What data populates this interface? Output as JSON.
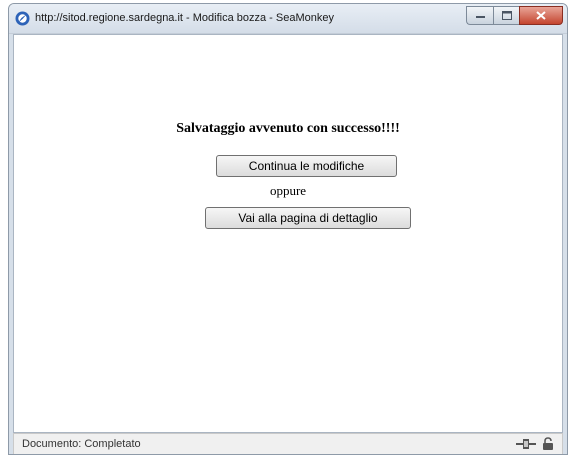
{
  "window": {
    "title": "http://sitod.regione.sardegna.it - Modifica bozza - SeaMonkey"
  },
  "page": {
    "message": "Salvataggio avvenuto con successo!!!!",
    "continue_button": "Continua le modifiche",
    "or_text": "oppure",
    "detail_button": "Vai alla pagina di dettaglio"
  },
  "statusbar": {
    "text": "Documento: Completato",
    "icons": [
      "network-icon",
      "lock-icon"
    ]
  },
  "colors": {
    "titlebar": "#d4dde8",
    "close_button": "#c4452f",
    "content_bg": "#ffffff",
    "statusbar_bg": "#f0f0f0"
  }
}
